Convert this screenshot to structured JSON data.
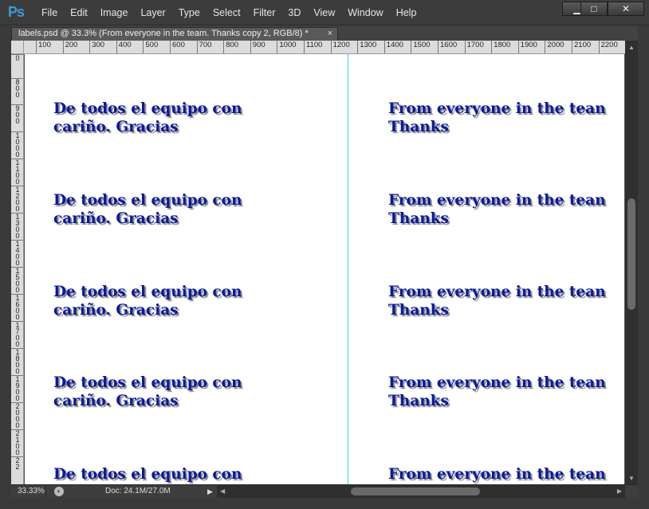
{
  "app": {
    "logo": "Ps"
  },
  "menu": [
    "File",
    "Edit",
    "Image",
    "Layer",
    "Type",
    "Select",
    "Filter",
    "3D",
    "View",
    "Window",
    "Help"
  ],
  "window_controls": {
    "minimize": "▁",
    "maximize": "□",
    "close": "✕"
  },
  "document_tab": {
    "title": "labels.psd @ 33.3% (From everyone in the team. Thanks copy 2, RGB/8) *",
    "close": "×"
  },
  "ruler_h": [
    "100",
    "200",
    "300",
    "400",
    "500",
    "600",
    "700",
    "800",
    "900",
    "1000",
    "1100",
    "1200",
    "1300",
    "1400",
    "1500",
    "1600",
    "1700",
    "1800",
    "1900",
    "2000",
    "2100",
    "2200"
  ],
  "ruler_v": [
    "0",
    "8\n0\n0",
    "9\n0\n0",
    "1\n0\n0\n0",
    "1\n1\n0\n0",
    "1\n2\n0\n0",
    "1\n3\n0\n0",
    "1\n4\n0\n0",
    "1\n5\n0\n0",
    "1\n6\n0\n0",
    "1\n7\n0\n0",
    "1\n8\n0\n0",
    "1\n9\n0\n0",
    "2\n0\n0\n0",
    "2\n1\n0\n0",
    "2\n2"
  ],
  "labels": {
    "left": [
      {
        "text": "De todos el equipo con\ncariño. Gracias"
      },
      {
        "text": "De todos el equipo con\ncariño. Gracias"
      },
      {
        "text": "De todos el equipo con\ncariño. Gracias"
      },
      {
        "text": "De todos el equipo con\ncariño. Gracias"
      },
      {
        "text": "De todos el equipo con"
      }
    ],
    "right": [
      {
        "text": "From everyone in the tean\nThanks"
      },
      {
        "text": "From everyone in the tean\nThanks"
      },
      {
        "text": "From everyone in the tean\nThanks"
      },
      {
        "text": "From everyone in the tean\nThanks"
      },
      {
        "text": "From everyone in the tean"
      }
    ]
  },
  "status": {
    "zoom": "33.33%",
    "doc_info": "Doc: 24.1M/27.0M",
    "arrow": "▶"
  },
  "colors": {
    "text": "#0b1a9a",
    "guide": "#38d8e8"
  }
}
